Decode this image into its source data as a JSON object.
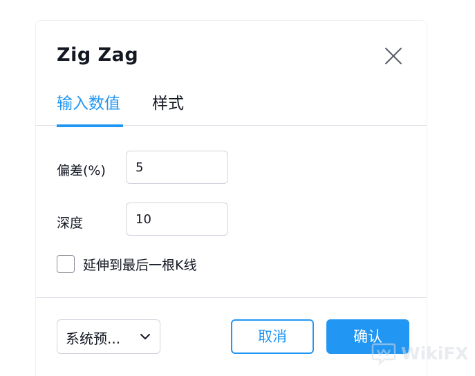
{
  "dialog": {
    "title": "Zig Zag",
    "close_icon": "close-icon"
  },
  "tabs": [
    {
      "label": "输入数值",
      "active": true
    },
    {
      "label": "样式",
      "active": false
    }
  ],
  "inputs": {
    "deviation": {
      "label": "偏差(%)",
      "value": "5"
    },
    "depth": {
      "label": "深度",
      "value": "10"
    }
  },
  "extend_checkbox": {
    "label": "延伸到最后一根K线",
    "checked": false
  },
  "footer": {
    "defaults_label": "系统预...",
    "defaults_icon": "chevron-down-icon",
    "cancel_label": "取消",
    "ok_label": "确认"
  },
  "watermark": {
    "text": "WikiFX"
  },
  "colors": {
    "accent": "#2196f3",
    "text": "#131722",
    "border": "#d1d4dc"
  }
}
